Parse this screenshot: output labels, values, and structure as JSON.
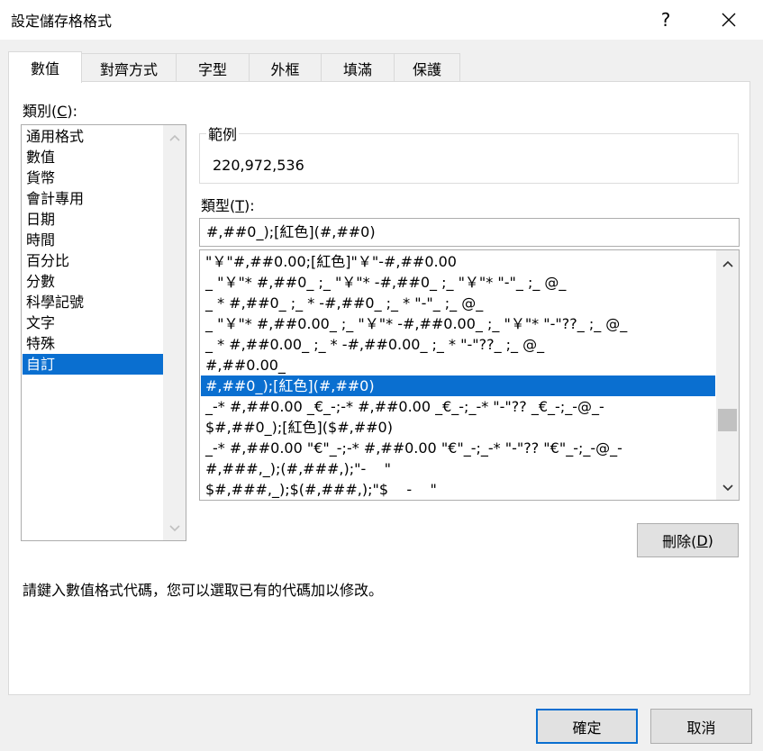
{
  "window": {
    "title": "設定儲存格格式",
    "help_label": "?"
  },
  "tabs": [
    {
      "label": "數值"
    },
    {
      "label": "對齊方式"
    },
    {
      "label": "字型"
    },
    {
      "label": "外框"
    },
    {
      "label": "填滿"
    },
    {
      "label": "保護"
    }
  ],
  "category": {
    "label_prefix": "類別(",
    "label_key": "C",
    "label_suffix": "):",
    "items": [
      {
        "label": "通用格式"
      },
      {
        "label": "數值"
      },
      {
        "label": "貨幣"
      },
      {
        "label": "會計專用"
      },
      {
        "label": "日期"
      },
      {
        "label": "時間"
      },
      {
        "label": "百分比"
      },
      {
        "label": "分數"
      },
      {
        "label": "科學記號"
      },
      {
        "label": "文字"
      },
      {
        "label": "特殊"
      },
      {
        "label": "自訂",
        "selected": true
      }
    ]
  },
  "sample": {
    "label": "範例",
    "value": "220,972,536"
  },
  "type": {
    "label_prefix": "類型(",
    "label_key": "T",
    "label_suffix": "):",
    "value": "#,##0_);[紅色](#,##0)"
  },
  "formats": [
    {
      "code": "\"￥\"#,##0.00;[紅色]\"￥\"-#,##0.00"
    },
    {
      "code": "_ \"￥\"* #,##0_ ;_ \"￥\"* -#,##0_ ;_ \"￥\"* \"-\"_ ;_ @_"
    },
    {
      "code": "_ * #,##0_ ;_ * -#,##0_ ;_ * \"-\"_ ;_ @_"
    },
    {
      "code": "_ \"￥\"* #,##0.00_ ;_ \"￥\"* -#,##0.00_ ;_ \"￥\"* \"-\"??_ ;_ @_"
    },
    {
      "code": "_ * #,##0.00_ ;_ * -#,##0.00_ ;_ * \"-\"??_ ;_ @_"
    },
    {
      "code": "#,##0.00_"
    },
    {
      "code": "#,##0_);[紅色](#,##0)",
      "selected": true
    },
    {
      "code": "_-* #,##0.00 _€_-;-* #,##0.00 _€_-;_-* \"-\"?? _€_-;_-@_-"
    },
    {
      "code": "$#,##0_);[紅色]($#,##0)"
    },
    {
      "code": "_-* #,##0.00 \"€\"_-;-* #,##0.00 \"€\"_-;_-* \"-\"?? \"€\"_-;_-@_-"
    },
    {
      "code": "#,###,_);(#,###,);\"-    \""
    },
    {
      "code": "$#,###,_);$(#,###,);\"$    -    \""
    }
  ],
  "buttons": {
    "delete_prefix": "刪除(",
    "delete_key": "D",
    "delete_suffix": ")",
    "ok": "確定",
    "cancel": "取消"
  },
  "hint": "請鍵入數值格式代碼，您可以選取已有的代碼加以修改。",
  "colors": {
    "selection": "#0a6fd0",
    "dialog_bg": "#f0f0f0",
    "button_bg": "#e1e1e1"
  },
  "icons": {
    "close": "close-icon",
    "scroll_up": "chevron-up-icon",
    "scroll_down": "chevron-down-icon"
  }
}
